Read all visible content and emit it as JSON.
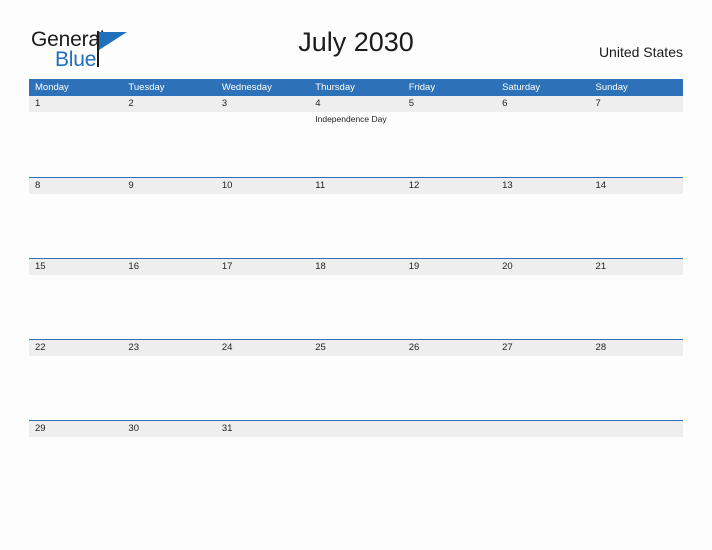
{
  "brand": {
    "name_top": "General",
    "name_bottom": "Blue",
    "accent_color": "#1f6fba",
    "flag_icon": "flag-triangle-icon"
  },
  "header": {
    "title": "July 2030",
    "country": "United States"
  },
  "calendar": {
    "header_bg": "#2d72b8",
    "day_band_bg": "#eeeeee",
    "weekdays": [
      "Monday",
      "Tuesday",
      "Wednesday",
      "Thursday",
      "Friday",
      "Saturday",
      "Sunday"
    ],
    "weeks": [
      [
        {
          "day": "1",
          "events": []
        },
        {
          "day": "2",
          "events": []
        },
        {
          "day": "3",
          "events": []
        },
        {
          "day": "4",
          "events": [
            "Independence Day"
          ]
        },
        {
          "day": "5",
          "events": []
        },
        {
          "day": "6",
          "events": []
        },
        {
          "day": "7",
          "events": []
        }
      ],
      [
        {
          "day": "8",
          "events": []
        },
        {
          "day": "9",
          "events": []
        },
        {
          "day": "10",
          "events": []
        },
        {
          "day": "11",
          "events": []
        },
        {
          "day": "12",
          "events": []
        },
        {
          "day": "13",
          "events": []
        },
        {
          "day": "14",
          "events": []
        }
      ],
      [
        {
          "day": "15",
          "events": []
        },
        {
          "day": "16",
          "events": []
        },
        {
          "day": "17",
          "events": []
        },
        {
          "day": "18",
          "events": []
        },
        {
          "day": "19",
          "events": []
        },
        {
          "day": "20",
          "events": []
        },
        {
          "day": "21",
          "events": []
        }
      ],
      [
        {
          "day": "22",
          "events": []
        },
        {
          "day": "23",
          "events": []
        },
        {
          "day": "24",
          "events": []
        },
        {
          "day": "25",
          "events": []
        },
        {
          "day": "26",
          "events": []
        },
        {
          "day": "27",
          "events": []
        },
        {
          "day": "28",
          "events": []
        }
      ],
      [
        {
          "day": "29",
          "events": []
        },
        {
          "day": "30",
          "events": []
        },
        {
          "day": "31",
          "events": []
        },
        {
          "day": "",
          "events": []
        },
        {
          "day": "",
          "events": []
        },
        {
          "day": "",
          "events": []
        },
        {
          "day": "",
          "events": []
        }
      ]
    ]
  }
}
